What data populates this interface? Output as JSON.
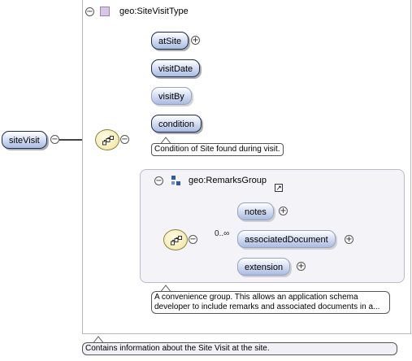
{
  "type": {
    "title": "geo:SiteVisitType"
  },
  "root": {
    "label": "siteVisit",
    "note": "Contains information about the Site Visit at the site."
  },
  "sequence_elements": [
    {
      "label": "atSite"
    },
    {
      "label": "visitDate"
    },
    {
      "label": "visitBy"
    },
    {
      "label": "condition"
    }
  ],
  "condition_note": "Condition of Site found during visit.",
  "group": {
    "title": "geo:RemarksGroup",
    "cardinality": "0..∞",
    "elements": [
      {
        "label": "notes"
      },
      {
        "label": "associatedDocument"
      },
      {
        "label": "extension"
      }
    ],
    "note": "A convenience group. This allows an application schema developer to include remarks and associated documents in a..."
  },
  "symbols": {
    "collapse": "−",
    "expand": "+"
  }
}
